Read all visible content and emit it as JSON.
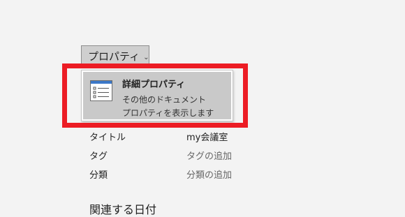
{
  "properties_button": {
    "label": "プロパティ",
    "chevron": "⌄"
  },
  "properties_menu": {
    "item": {
      "icon": "document-properties-icon",
      "title": "詳細プロパティ",
      "desc_line1": "その他のドキュメント",
      "desc_line2": "プロパティを表示します"
    }
  },
  "highlight": {
    "color": "#ec1c24"
  },
  "properties": [
    {
      "label": "タイトル",
      "value": "my会議室"
    },
    {
      "label": "タグ",
      "value": "タグの追加"
    },
    {
      "label": "分類",
      "value": "分類の追加"
    }
  ],
  "related_dates": {
    "heading": "関連する日付"
  }
}
